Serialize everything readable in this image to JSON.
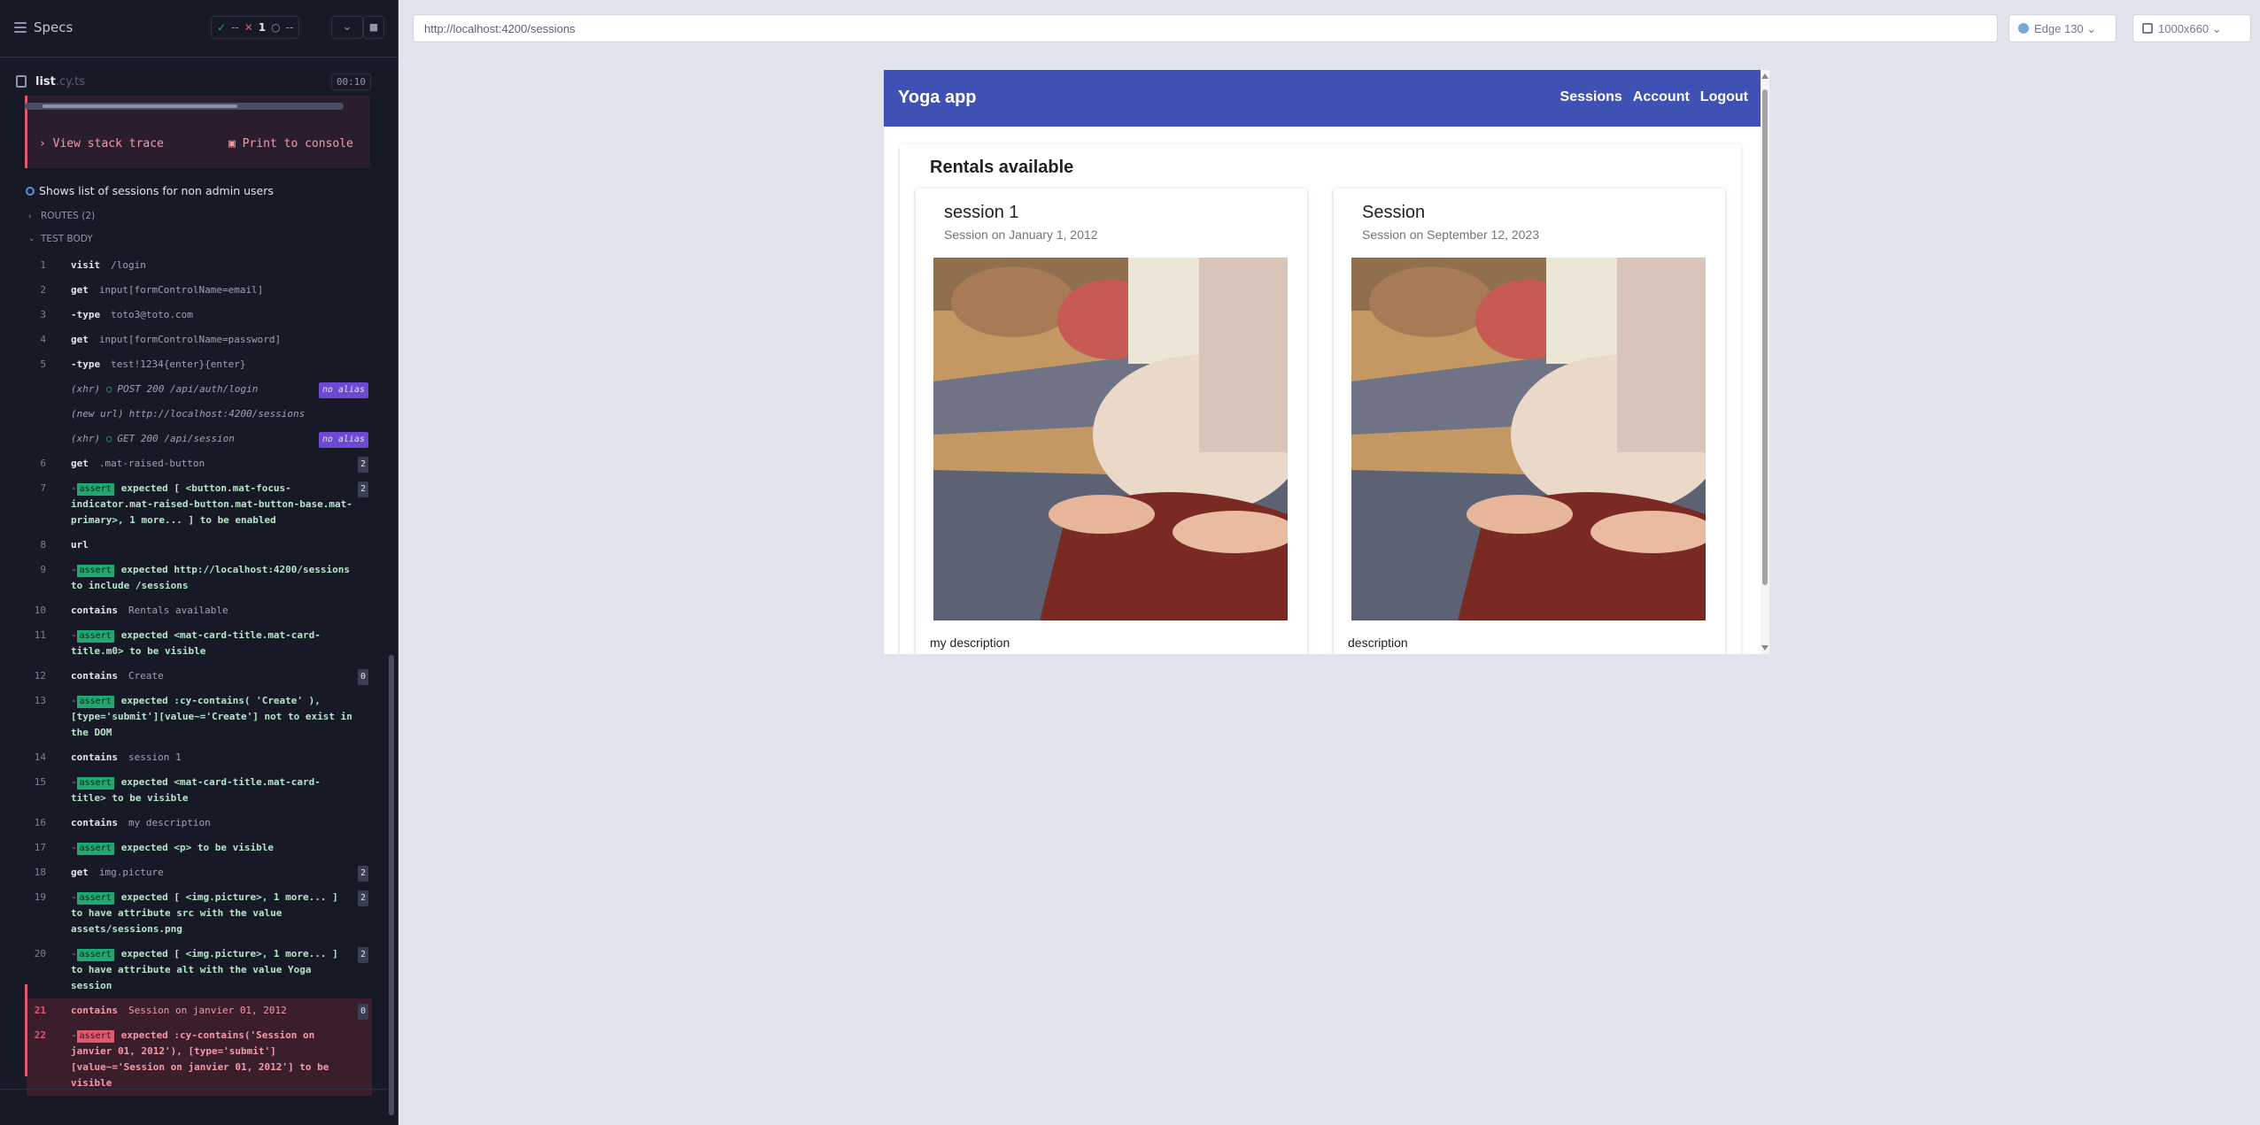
{
  "reporter": {
    "header": {
      "title": "Specs",
      "stats": {
        "passed": "--",
        "failed": "1",
        "pending": "--"
      }
    },
    "file": {
      "name": "list",
      "ext": ".cy.ts",
      "duration": "00:10"
    },
    "error": {
      "stack_trace": "View stack trace",
      "print": "Print to console"
    },
    "test": {
      "title": "Shows list of sessions for non admin users",
      "routes_label": "ROUTES (2)",
      "body_label": "TEST BODY"
    },
    "commands": [
      {
        "num": "1",
        "name": "visit",
        "msg": "/login"
      },
      {
        "num": "2",
        "name": "get",
        "msg": "input[formControlName=email]"
      },
      {
        "num": "3",
        "name": "-type",
        "msg": "toto3@toto.com"
      },
      {
        "num": "4",
        "name": "get",
        "msg": "input[formControlName=password]"
      },
      {
        "num": "5",
        "name": "-type",
        "msg": "test!1234{enter}{enter}"
      },
      {
        "num": "",
        "sub": "(xhr)",
        "msg": "POST 200 /api/auth/login",
        "alias": "no alias"
      },
      {
        "num": "",
        "sub": "(new url)",
        "msg": "http://localhost:4200/sessions"
      },
      {
        "num": "",
        "sub": "(xhr)",
        "msg": "GET 200 /api/session",
        "alias": "no alias"
      },
      {
        "num": "6",
        "name": "get",
        "msg": ".mat-raised-button",
        "count": "2"
      },
      {
        "num": "7",
        "badge": "assert",
        "l1": "expected [ <button.mat-focus-",
        "l2": "indicator.mat-raised-button.mat-button-base.mat-",
        "l3": "primary>, 1 more... ] to be enabled",
        "count": "2"
      },
      {
        "num": "8",
        "name": "url",
        "msg": ""
      },
      {
        "num": "9",
        "badge": "assert",
        "l1": "expected http://localhost:4200/sessions",
        "l2": "to include /sessions"
      },
      {
        "num": "10",
        "name": "contains",
        "msg": "Rentals available"
      },
      {
        "num": "11",
        "badge": "assert",
        "l1": "expected <mat-card-title.mat-card-",
        "l2": "title.m0> to be visible"
      },
      {
        "num": "12",
        "name": "contains",
        "msg": "Create",
        "count": "0"
      },
      {
        "num": "13",
        "badge": "assert",
        "l1": "expected :cy-contains( 'Create' ),",
        "l2": "[type='submit'][value~='Create'] not to exist in",
        "l3": "the DOM"
      },
      {
        "num": "14",
        "name": "contains",
        "msg": "session 1"
      },
      {
        "num": "15",
        "badge": "assert",
        "l1": "expected <mat-card-title.mat-card-",
        "l2": "title> to be visible"
      },
      {
        "num": "16",
        "name": "contains",
        "msg": "my description"
      },
      {
        "num": "17",
        "badge": "assert",
        "l1": "expected <p> to be visible"
      },
      {
        "num": "18",
        "name": "get",
        "msg": "img.picture",
        "count": "2"
      },
      {
        "num": "19",
        "badge": "assert",
        "l1": "expected [ <img.picture>, 1 more... ]",
        "l2": "to have attribute src with the value",
        "l3": "assets/sessions.png",
        "count": "2"
      },
      {
        "num": "20",
        "badge": "assert",
        "l1": "expected [ <img.picture>, 1 more... ]",
        "l2": "to have attribute alt with the value Yoga",
        "l3": "session",
        "count": "2"
      },
      {
        "num": "21",
        "name": "contains",
        "msg": "Session on janvier 01, 2012",
        "count": "0",
        "failed": true
      },
      {
        "num": "22",
        "badge": "assert",
        "l1": "expected :cy-contains('Session on",
        "l2": "janvier 01, 2012'), [type='submit']",
        "l3": "[value~='Session on janvier 01, 2012'] to be",
        "l4": "visible",
        "failed": true
      }
    ]
  },
  "runner": {
    "url": "http://localhost:4200/sessions",
    "browser": "Edge 130",
    "viewport": "1000x660"
  },
  "app": {
    "title": "Yoga app",
    "nav": [
      "Sessions",
      "Account",
      "Logout"
    ],
    "heading": "Rentals available",
    "sessions": [
      {
        "title": "session 1",
        "subtitle": "Session on January 1, 2012",
        "description": "my description"
      },
      {
        "title": "Session",
        "subtitle": "Session on September 12, 2023",
        "description": "description"
      }
    ]
  },
  "colors": {
    "reporter_bg": "#171926",
    "toolbar": "#3f51b5",
    "pass": "#1fa971",
    "fail": "#e45770",
    "alias": "#6c4ad6"
  }
}
